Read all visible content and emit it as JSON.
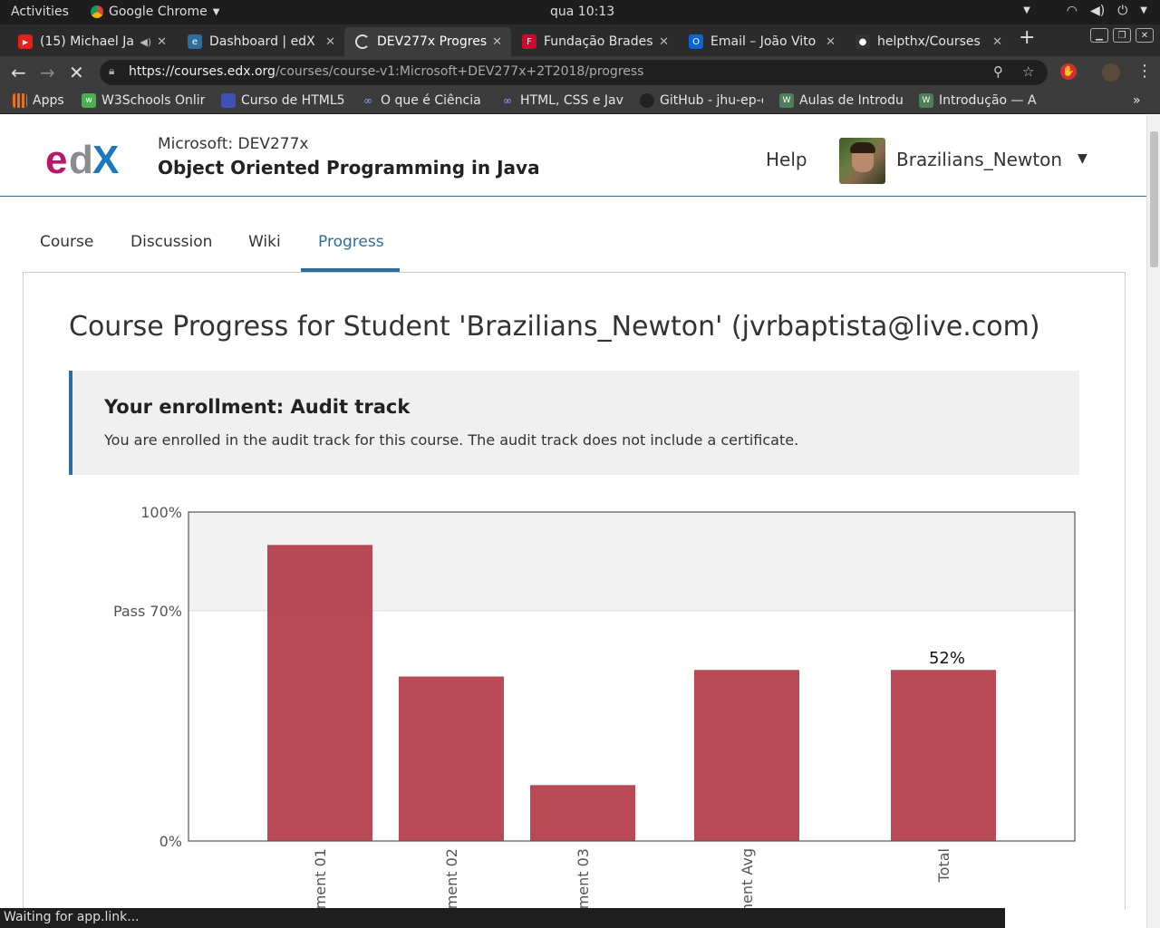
{
  "system": {
    "activities": "Activities",
    "app_name": "Google Chrome",
    "clock": "qua 10:13"
  },
  "tabs": [
    {
      "title": "(15) Michael Ja",
      "favicon_color": "#e62117",
      "favicon": "▶"
    },
    {
      "title": "Dashboard | edX",
      "favicon_color": "#2d6e9e",
      "favicon": "e"
    },
    {
      "title": "DEV277x Progres",
      "favicon_color": "#3c3c3c",
      "favicon": "C",
      "active": true
    },
    {
      "title": "Fundação Brades",
      "favicon_color": "#cc092f",
      "favicon": "F"
    },
    {
      "title": "Email – João Vito",
      "favicon_color": "#0a64d6",
      "favicon": "O"
    },
    {
      "title": "helpthx/Courses",
      "favicon_color": "#333333",
      "favicon": "●"
    }
  ],
  "toolbar": {
    "url_host": "https://courses.edx.org",
    "url_path": "/courses/course-v1:Microsoft+DEV277x+2T2018/progress"
  },
  "bookmarks": [
    {
      "label": "Apps",
      "color": "#e8711c"
    },
    {
      "label": "W3Schools Onlir",
      "color": "#4caf50"
    },
    {
      "label": "Curso de HTML5",
      "color": "#3f51b5"
    },
    {
      "label": "O que é Ciência c",
      "color": "#5c6bc0"
    },
    {
      "label": "HTML, CSS e Jav",
      "color": "#5c6bc0"
    },
    {
      "label": "GitHub - jhu-ep-c",
      "color": "#333333"
    },
    {
      "label": "Aulas de Introdu",
      "color": "#4e7f5a"
    },
    {
      "label": "Introdução — A",
      "color": "#4e7f5a"
    }
  ],
  "header": {
    "course_org": "Microsoft: DEV277x",
    "course_name": "Object Oriented Programming in Java",
    "help": "Help",
    "username": "Brazilians_Newton"
  },
  "course_nav": [
    "Course",
    "Discussion",
    "Wiki",
    "Progress"
  ],
  "progress": {
    "title": "Course Progress for Student 'Brazilians_Newton' (jvrbaptista@live.com)",
    "enroll_heading": "Your enrollment: Audit track",
    "enroll_text": "You are enrolled in the audit track for this course. The audit track does not include a certificate."
  },
  "chart_data": {
    "type": "bar",
    "categories": [
      "ment 01",
      "ment 02",
      "ment 03",
      "ment Avg",
      "Total"
    ],
    "values": [
      90,
      50,
      17,
      52,
      52
    ],
    "value_labels": [
      "",
      "",
      "",
      "",
      "52%"
    ],
    "ytick_labels": [
      "100%",
      "Pass 70%",
      "0%"
    ],
    "yticks": [
      100,
      70,
      0
    ],
    "ylim": [
      0,
      100
    ],
    "pass_threshold": 70,
    "bar_color": "#b33a47",
    "pass_band_color": "#f2f2f2"
  },
  "status_text": "Waiting for app.link..."
}
